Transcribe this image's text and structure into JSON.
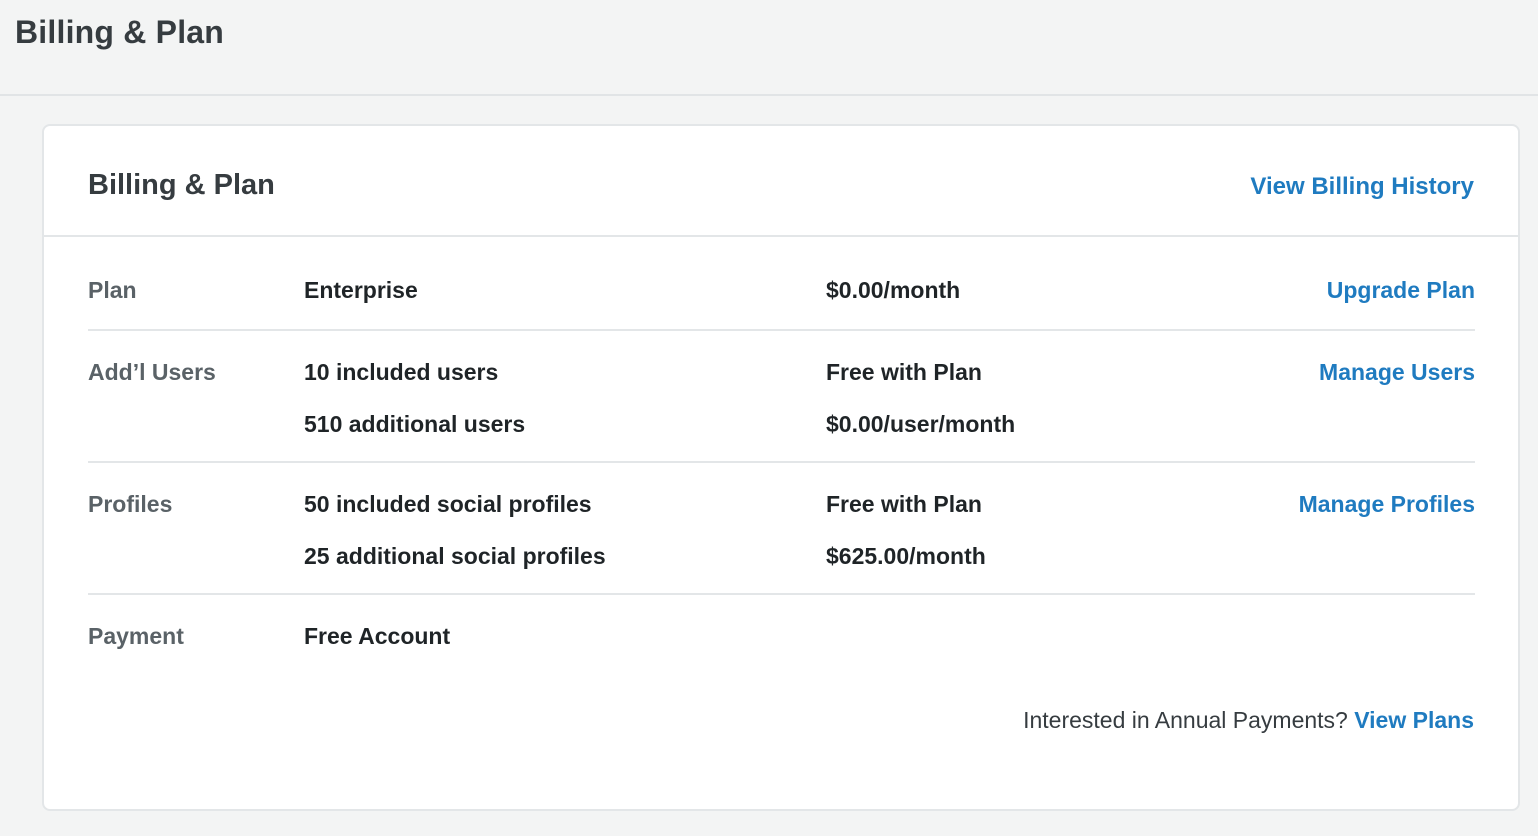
{
  "header": {
    "title": "Billing & Plan"
  },
  "card": {
    "title": "Billing & Plan",
    "history_link": "View Billing History"
  },
  "rows": {
    "plan": {
      "label": "Plan",
      "desc": "Enterprise",
      "price": "$0.00/month",
      "action": "Upgrade Plan"
    },
    "users": {
      "label": "Add’l Users",
      "line1_desc": "10 included users",
      "line1_price": "Free with Plan",
      "line2_desc": "510 additional users",
      "line2_price": "$0.00/user/month",
      "action": "Manage Users"
    },
    "profiles": {
      "label": "Profiles",
      "line1_desc": "50 included social profiles",
      "line1_price": "Free with Plan",
      "line2_desc": "25 additional social profiles",
      "line2_price": "$625.00/month",
      "action": "Manage Profiles"
    },
    "payment": {
      "label": "Payment",
      "desc": "Free Account"
    }
  },
  "annual": {
    "text": "Interested in Annual Payments?",
    "link": "View Plans"
  },
  "colors": {
    "link": "#1f7bc0",
    "background": "#f3f4f4",
    "card": "#ffffff",
    "divider": "#e3e6e8"
  }
}
